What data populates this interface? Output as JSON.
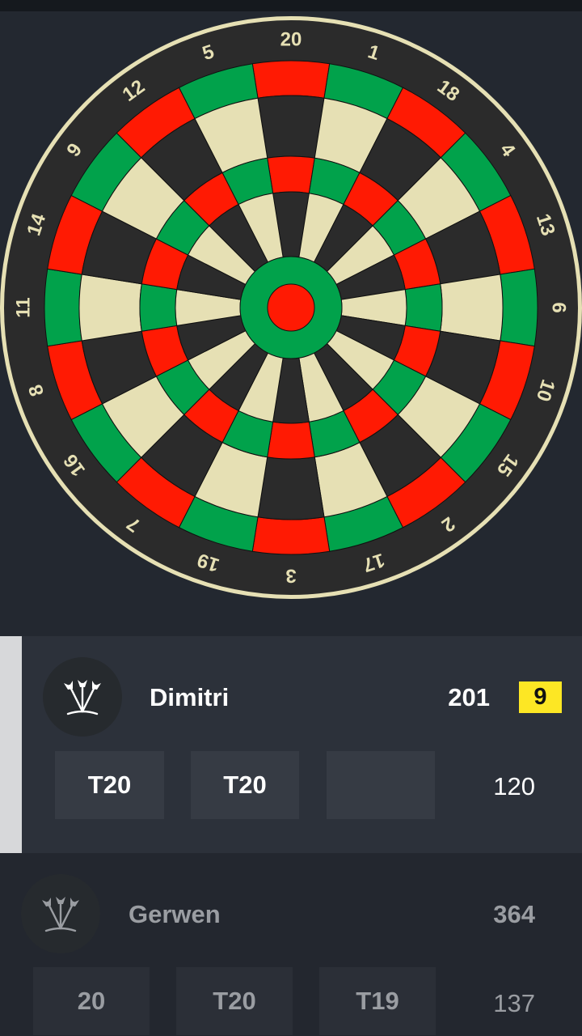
{
  "dartboard": {
    "numbers": [
      "20",
      "1",
      "18",
      "4",
      "13",
      "6",
      "10",
      "15",
      "2",
      "17",
      "3",
      "19",
      "7",
      "16",
      "8",
      "11",
      "14",
      "9",
      "12",
      "5"
    ],
    "colors": {
      "background": "#232830",
      "dark": "#2b2b2b",
      "light": "#e6e0b4",
      "red": "#ff1a03",
      "green": "#01a24b",
      "wire": "#101010",
      "rim": "#e6e0b4",
      "number_text": "#e6e0b4"
    }
  },
  "players": [
    {
      "name": "Dimitri",
      "score": "201",
      "darts_left": "9",
      "throws": [
        "T20",
        "T20",
        ""
      ],
      "turn_total": "120",
      "active": true,
      "avatar_icon": "darts-icon"
    },
    {
      "name": "Gerwen",
      "score": "364",
      "throws": [
        "20",
        "T20",
        "T19"
      ],
      "turn_total": "137",
      "active": false,
      "avatar_icon": "darts-icon"
    }
  ],
  "colors": {
    "active_panel": "#2c313a",
    "waiting_panel": "#23272f",
    "active_indicator": "#d7d8da",
    "badge": "#fde724"
  }
}
